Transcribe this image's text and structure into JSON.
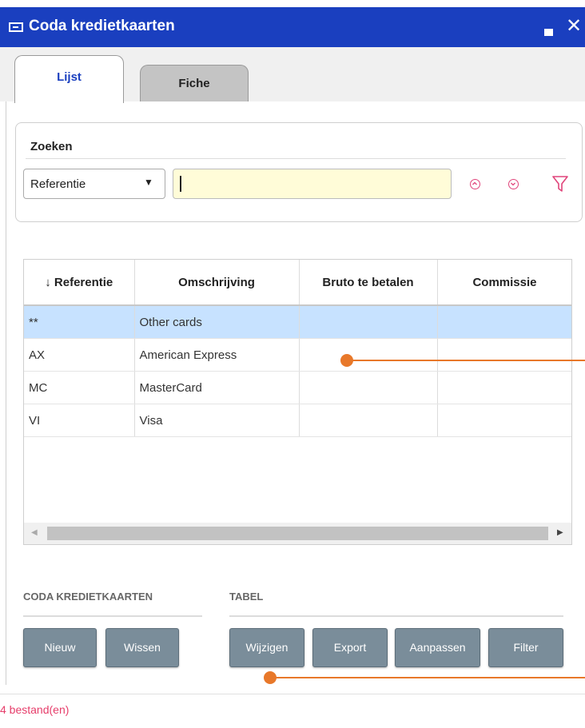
{
  "window": {
    "title": "Coda kredietkaarten",
    "buttons": {
      "maximize_icon": "maximize-icon",
      "close_label": "✕"
    }
  },
  "tabs": [
    {
      "label": "Lijst",
      "active": true
    },
    {
      "label": "Fiche",
      "active": false
    }
  ],
  "search": {
    "label": "Zoeken",
    "field_select": {
      "value": "Referentie",
      "arrow": "▼"
    },
    "input_value": ""
  },
  "grid": {
    "columns": [
      "↓ Referentie",
      "Omschrijving",
      "Bruto te betalen",
      "Commissie"
    ],
    "rows": [
      {
        "ref": "**",
        "desc": "Other cards",
        "bruto": "",
        "commissie": "",
        "selected": true
      },
      {
        "ref": "AX",
        "desc": "American Express",
        "bruto": "",
        "commissie": ""
      },
      {
        "ref": "MC",
        "desc": "MasterCard",
        "bruto": "",
        "commissie": ""
      },
      {
        "ref": "VI",
        "desc": "Visa",
        "bruto": "",
        "commissie": ""
      }
    ],
    "scroll": {
      "left": "◀",
      "right": "▶"
    }
  },
  "sections": {
    "coda": {
      "title": "CODA KREDIETKAARTEN",
      "buttons": [
        "Nieuw",
        "Wissen"
      ]
    },
    "tabel": {
      "title": "TABEL",
      "buttons": [
        "Wijzigen",
        "Export",
        "Aanpassen",
        "Filter"
      ]
    }
  },
  "status": "4 bestand(en)",
  "colors": {
    "titlebar": "#1a3fbf",
    "selected_row": "#c7e2ff",
    "button": "#7a8d9a",
    "status_text": "#e63d6a",
    "callout": "#e8782a"
  }
}
